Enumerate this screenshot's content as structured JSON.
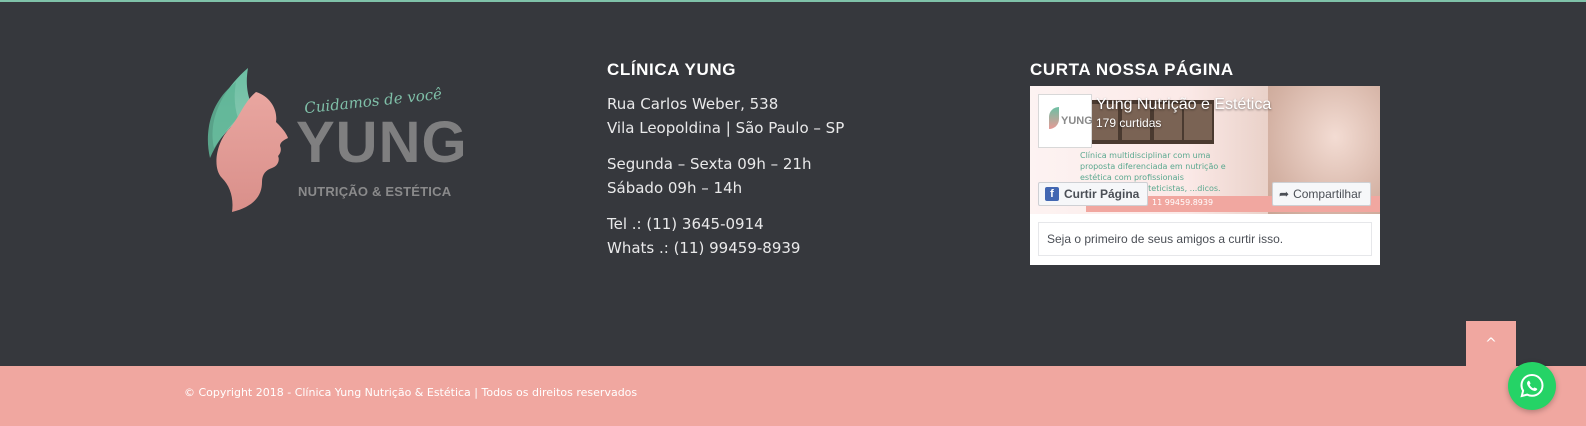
{
  "logo": {
    "tagline": "Cuidamos de você",
    "wordmark": "YUNG",
    "subtitle": "NUTRIÇÃO & ESTÉTICA"
  },
  "clinic": {
    "title": "CLÍNICA YUNG",
    "address_line1": "Rua Carlos Weber, 538",
    "address_line2": "Vila Leopoldina | São Paulo – SP",
    "hours_weekday": "Segunda – Sexta 09h – 21h",
    "hours_saturday": "Sábado 09h – 14h",
    "phone": "Tel .: (11) 3645-0914",
    "whatsapp": "Whats .: (11) 99459-8939"
  },
  "facebook": {
    "title": "CURTA NOSSA PÁGINA",
    "page_name": "Yung Nutrição e Estética",
    "likes": "179 curtidas",
    "cover_text": "Clínica multidisciplinar com uma proposta diferenciada em nutrição e estética com profissionais nutricionistas, esteticistas, ...dicos. Consulte-nos!",
    "cover_phone": "11 99459.8939",
    "pic_word": "YUNG",
    "like_button": "Curtir Página",
    "share_button": "Compartilhar",
    "friends_text": "Seja o primeiro de seus amigos a curtir isso.",
    "brand_color": "#4267b2"
  },
  "footer": {
    "copyright": "© Copyright 2018 - Clínica Yung Nutrição & Estética | Todos os direitos reservados",
    "back_to_top": "^"
  },
  "colors": {
    "background": "#36383d",
    "accent_pink": "#f0a7a0",
    "accent_green": "#7fc2a9",
    "whatsapp_green": "#25d366"
  }
}
